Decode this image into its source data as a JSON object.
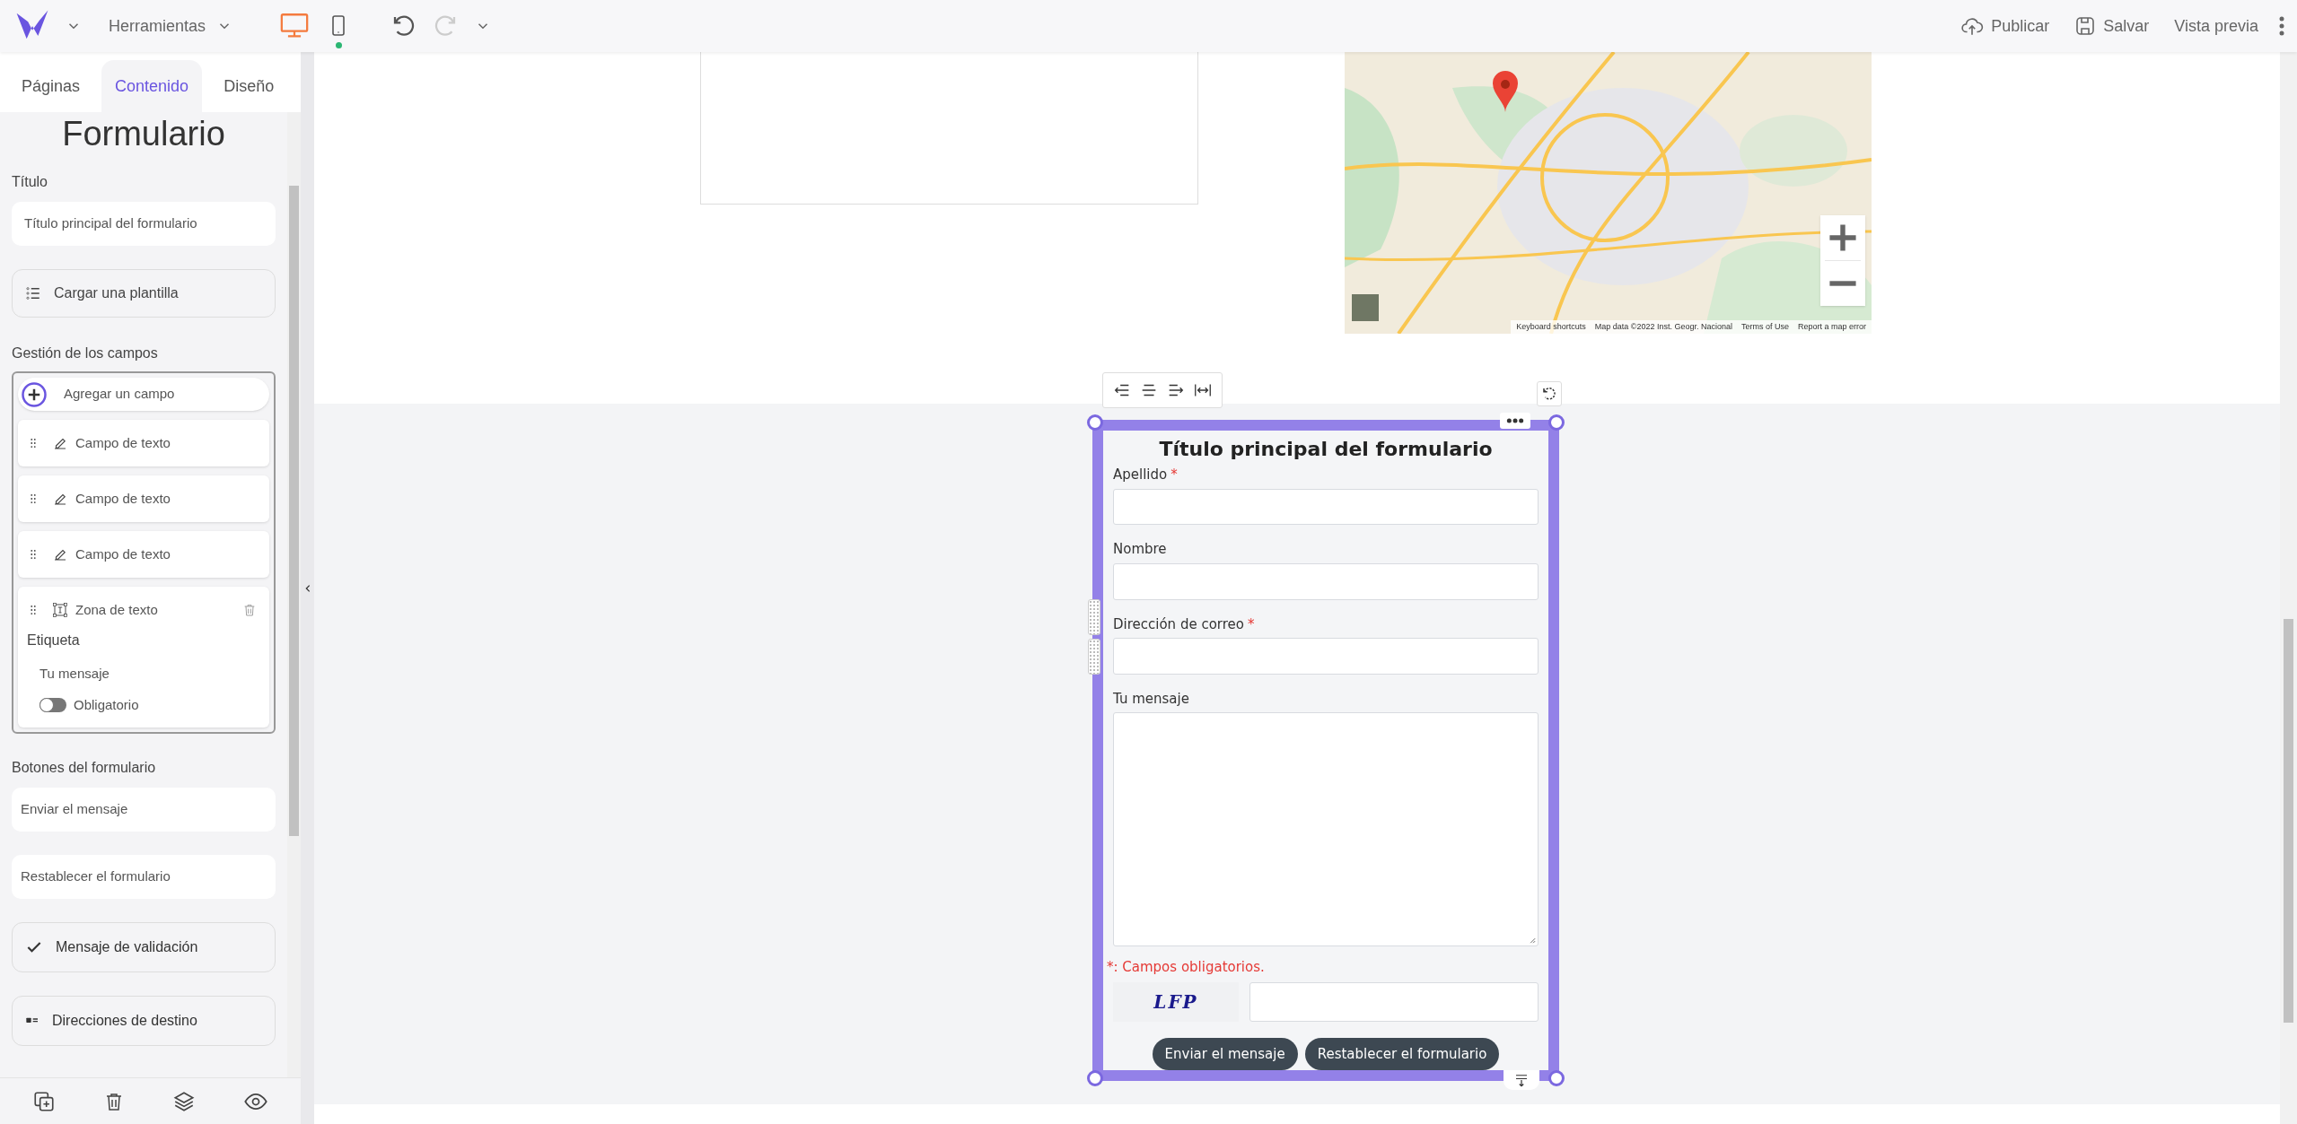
{
  "toolbar": {
    "tools_menu": "Herramientas",
    "devices": [
      {
        "kind": "desktop",
        "selected": true,
        "dot": false
      },
      {
        "kind": "mobile",
        "selected": false,
        "dot": true
      }
    ],
    "history": [
      {
        "kind": "undo",
        "disabled": false
      },
      {
        "kind": "redo",
        "disabled": true
      }
    ],
    "actions": [
      {
        "kind": "publish",
        "label": "Publicar"
      },
      {
        "kind": "save",
        "label": "Salvar"
      },
      {
        "kind": "preview",
        "label": "Vista previa"
      }
    ]
  },
  "sidebar": {
    "tabs": [
      {
        "label": "Páginas",
        "selected": false
      },
      {
        "label": "Contenido",
        "selected": true
      },
      {
        "label": "Diseño",
        "selected": false
      }
    ],
    "heading": "Formulario",
    "title_label": "Título",
    "title_value": "Título principal del formulario",
    "template_button": "Cargar una plantilla",
    "fields_label": "Gestión de los campos",
    "add_field": "Agregar un campo",
    "fields": [
      {
        "kind": "text",
        "label": "Campo de texto",
        "expanded": false
      },
      {
        "kind": "text",
        "label": "Campo de texto",
        "expanded": false
      },
      {
        "kind": "text",
        "label": "Campo de texto",
        "expanded": false
      },
      {
        "kind": "textarea",
        "label": "Zona de texto",
        "expanded": true,
        "detail_label": "Etiqueta",
        "detail_value": "Tu mensaje",
        "required_label": "Obligatorio",
        "required": false
      }
    ],
    "buttons_label": "Botones del formulario",
    "button_values": [
      "Enviar el mensaje",
      "Restablecer el formulario"
    ],
    "options": [
      {
        "kind": "validation",
        "label": "Mensaje de validación"
      },
      {
        "kind": "recipients",
        "label": "Direcciones de destino"
      }
    ]
  },
  "map": {
    "kind": "picture",
    "attribution": [
      "Keyboard shortcuts",
      "Map data ©2022 Inst. Geogr. Nacional",
      "Terms of Use",
      "Report a map error"
    ]
  },
  "form": {
    "title": "Título principal del formulario",
    "required_mark": "*",
    "fields": [
      {
        "kind": "input",
        "label": "Apellido",
        "required": true
      },
      {
        "kind": "input",
        "label": "Nombre",
        "required": false
      },
      {
        "kind": "input",
        "label": "Dirección de correo",
        "required": true
      },
      {
        "kind": "textarea",
        "label": "Tu mensaje",
        "required": false
      }
    ],
    "required_note": "*: Campos obligatorios.",
    "captcha": "LFP",
    "buttons": [
      "Enviar el mensaje",
      "Restablecer el formulario"
    ]
  }
}
